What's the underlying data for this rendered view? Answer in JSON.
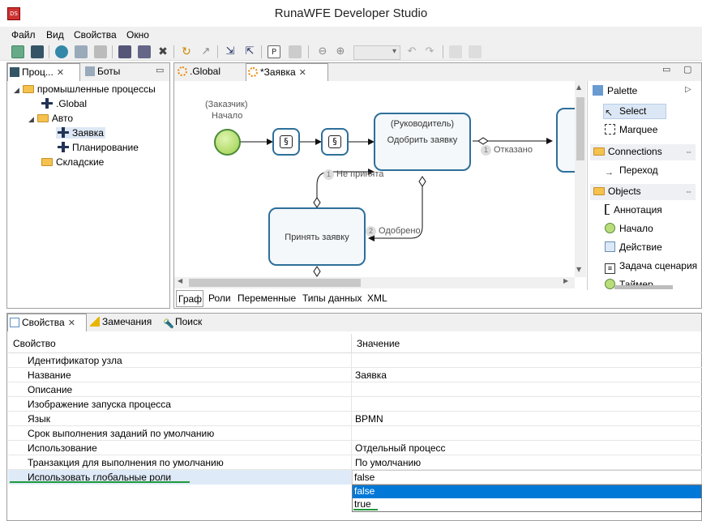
{
  "window": {
    "title": "RunaWFE Developer Studio",
    "icon_text": "DS"
  },
  "menu": [
    "Файл",
    "Вид",
    "Свойства",
    "Окно"
  ],
  "left_panel": {
    "tabs": [
      {
        "label": "Проц..."
      },
      {
        "label": "Боты"
      }
    ],
    "tree": [
      {
        "label": "промышленные процессы",
        "level": 0,
        "icon": "folder-icon",
        "expanded": true
      },
      {
        "label": ".Global",
        "level": 1,
        "icon": "process-icon"
      },
      {
        "label": "Авто",
        "level": 1,
        "icon": "folder-icon",
        "expanded": true
      },
      {
        "label": "Заявка",
        "level": 2,
        "icon": "process-icon",
        "selected": true
      },
      {
        "label": "Планирование",
        "level": 2,
        "icon": "process-icon"
      },
      {
        "label": "Складские",
        "level": 1,
        "icon": "folder-icon"
      }
    ]
  },
  "editor": {
    "tabs": [
      {
        "label": ".Global"
      },
      {
        "label": "*Заявка"
      }
    ],
    "bottom_tabs": [
      "Граф",
      "Роли",
      "Переменные",
      "Типы данных",
      "XML"
    ],
    "diagram": {
      "start": {
        "role": "(Заказчик)",
        "label": "Начало"
      },
      "task1": {
        "role": "(Руководитель)",
        "label": "Одобрить заявку"
      },
      "task2": {
        "label": "Принять заявку"
      },
      "edges": [
        {
          "num": "1",
          "label": "Не принята"
        },
        {
          "num": "1",
          "label": "Отказано"
        },
        {
          "num": "2",
          "label": "Одобрено"
        }
      ]
    }
  },
  "palette": {
    "title": "Palette",
    "tools": [
      {
        "label": "Select"
      },
      {
        "label": "Marquee"
      }
    ],
    "sections": [
      {
        "label": "Connections",
        "items": [
          "Переход"
        ]
      },
      {
        "label": "Objects",
        "items": [
          "Аннотация",
          "Начало",
          "Действие",
          "Задача сценария",
          "Таймер"
        ]
      }
    ]
  },
  "bottom_panel": {
    "tabs": [
      {
        "label": "Свойства"
      },
      {
        "label": "Замечания"
      },
      {
        "label": "Поиск"
      }
    ],
    "columns": [
      "Свойство",
      "Значение"
    ],
    "rows": [
      {
        "name": "Идентификатор узла",
        "value": ""
      },
      {
        "name": "Название",
        "value": "Заявка"
      },
      {
        "name": "Описание",
        "value": ""
      },
      {
        "name": "Изображение запуска процесса",
        "value": ""
      },
      {
        "name": "Язык",
        "value": "BPMN"
      },
      {
        "name": "Срок выполнения заданий по умолчанию",
        "value": ""
      },
      {
        "name": "Использование",
        "value": "Отдельный процесс"
      },
      {
        "name": "Транзакция для выполнения по умолчанию",
        "value": "По умолчанию"
      },
      {
        "name": "Использовать глобальные роли",
        "value": "false"
      }
    ],
    "dropdown_options": [
      "false",
      "true"
    ],
    "dropdown_selected": "false"
  },
  "colors": {
    "accent": "#2e6f9a",
    "selection": "#0078d7",
    "highlight_underline": "#1e9a3a"
  }
}
